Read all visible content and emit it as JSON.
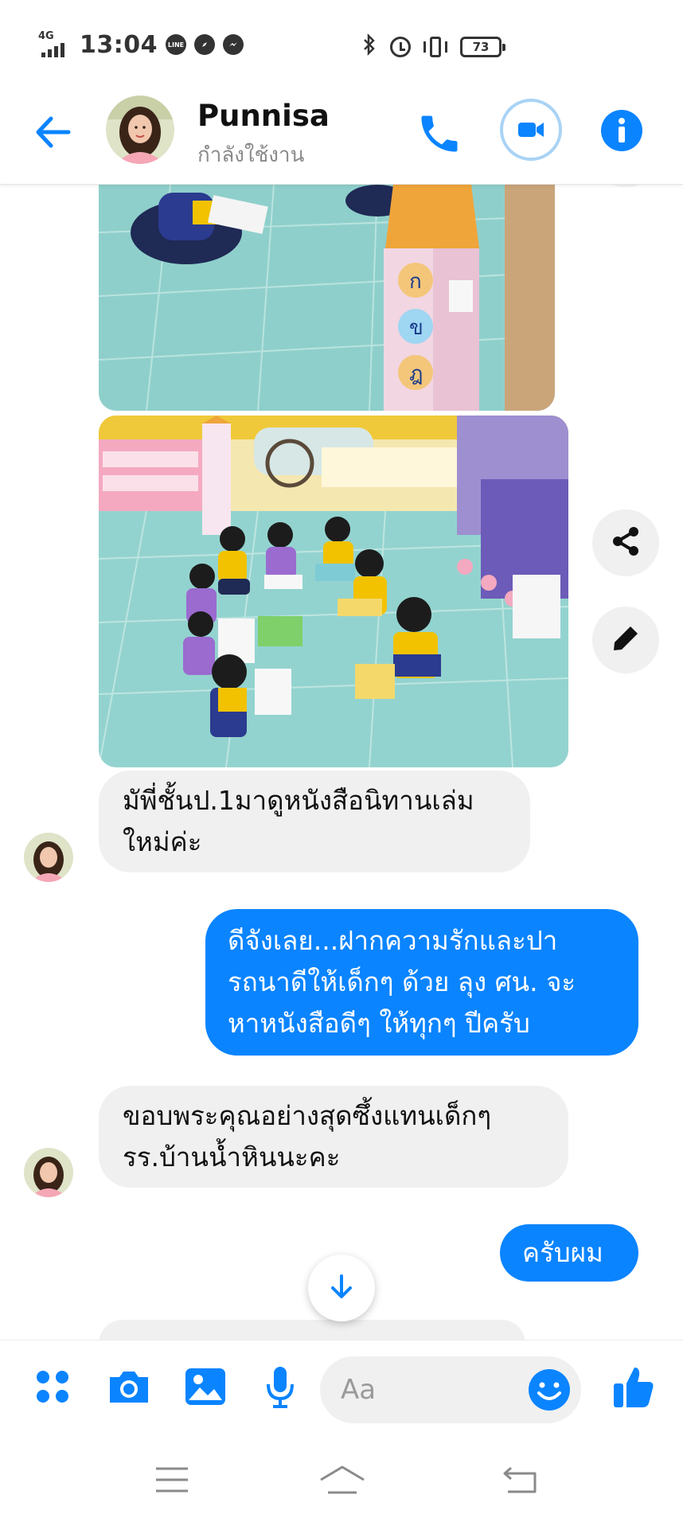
{
  "status_bar": {
    "network": "4G",
    "time": "13:04",
    "app_icons": [
      "line-icon",
      "compass-icon",
      "messenger-icon"
    ],
    "battery": "73"
  },
  "header": {
    "contact_name": "Punnisa",
    "contact_status": "กำลังใช้งาน",
    "accent_color": "#0a84ff"
  },
  "messages": [
    {
      "direction": "incoming",
      "text": "มัพี่ชั้นป.1มาดูหนังสือนิทานเล่มใหม่ค่ะ",
      "lines": [
        "มัพี่ชั้นป.1มาดูหนังสือนิทานเล่ม",
        "ใหม่ค่ะ"
      ]
    },
    {
      "direction": "outgoing",
      "text": "ดีจังเลย...ฝากความรักและปารถนาดีให้เด็กๆ ด้วย ลุง ศน. จะหาหนังสือดีๆ ให้ทุกๆ ปีครับ",
      "lines": [
        "ดีจังเลย...ฝากความรักและปา",
        "รถนาดีให้เด็กๆ ด้วย ลุง ศน. จะ",
        "หาหนังสือดีๆ ให้ทุกๆ ปีครับ"
      ]
    },
    {
      "direction": "incoming",
      "text": "ขอบพระคุณอย่างสุดซึ้งแทนเด็กๆรร.บ้านน้ำหินนะคะ",
      "lines": [
        "ขอบพระคุณอย่างสุดซึ้งแทนเด็กๆ",
        "รร.บ้านน้ำหินนะคะ"
      ]
    },
    {
      "direction": "outgoing",
      "text": "ครับผม",
      "lines": [
        "ครับผม"
      ]
    }
  ],
  "composer": {
    "placeholder": "Aa",
    "icons": [
      "apps-icon",
      "camera-icon",
      "gallery-icon",
      "microphone-icon",
      "emoji-icon",
      "thumbs-up-icon"
    ]
  },
  "side_actions": [
    "share-icon",
    "edit-icon"
  ],
  "nav_bar": [
    "menu-icon",
    "home-icon",
    "back-icon"
  ]
}
